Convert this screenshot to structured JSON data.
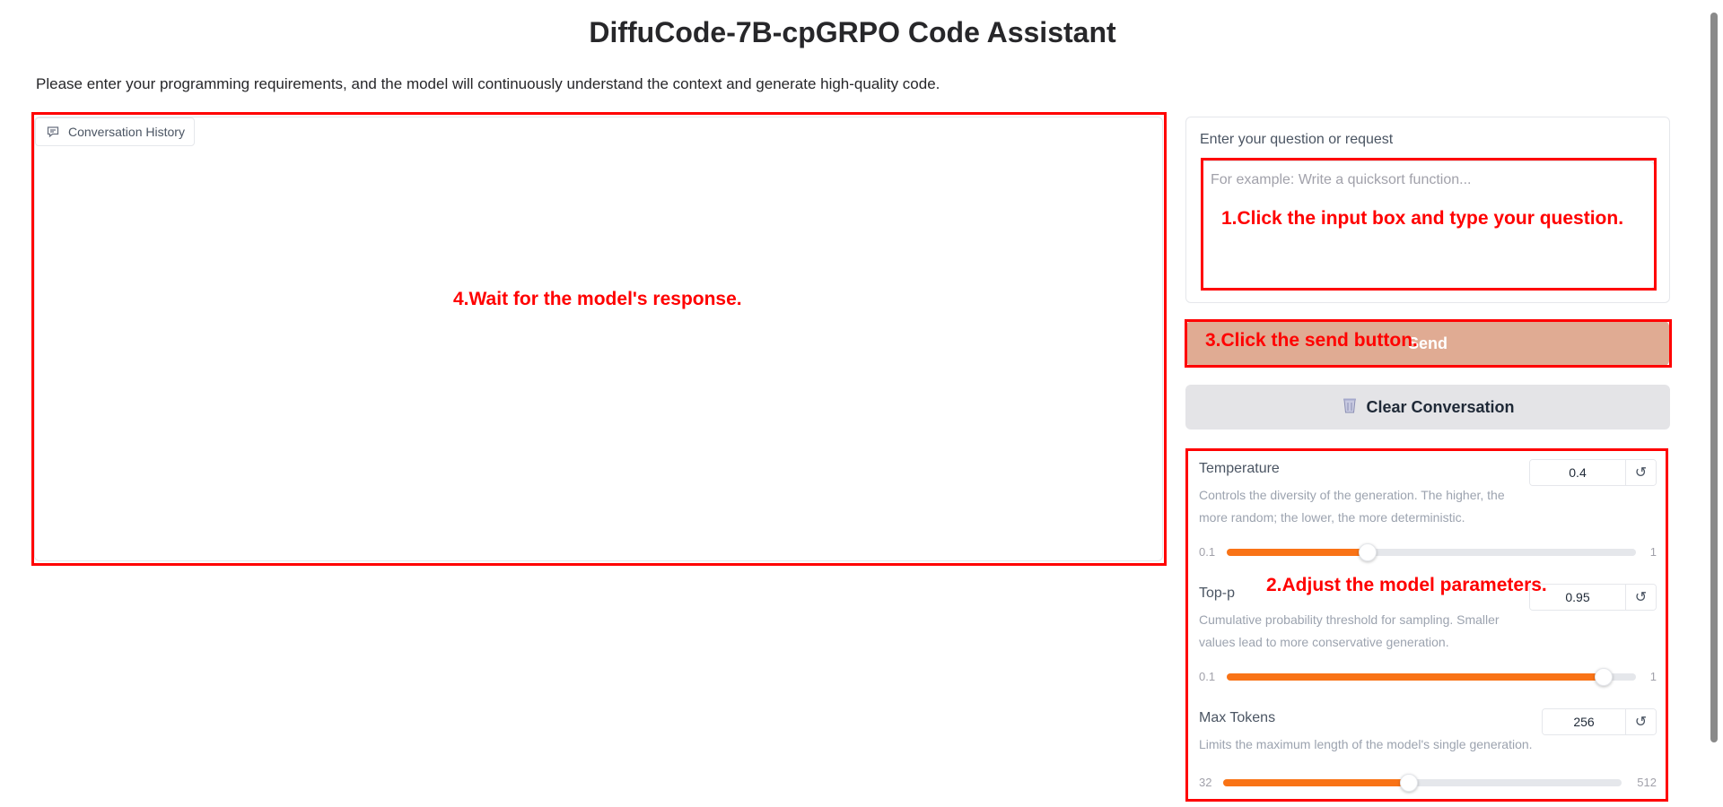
{
  "page": {
    "title": "DiffuCode-7B-cpGRPO Code Assistant",
    "description": "Please enter your programming requirements, and the model will continuously understand the context and generate high-quality code."
  },
  "chat": {
    "label": "Conversation History",
    "icon": "chat-bubble-icon"
  },
  "input": {
    "label": "Enter your question or request",
    "placeholder": "For example: Write a quicksort function...",
    "value": ""
  },
  "buttons": {
    "send": "Send",
    "clear": "Clear Conversation",
    "clear_icon": "trash-icon",
    "reset_icon": "reset-icon"
  },
  "params": {
    "temperature": {
      "name": "Temperature",
      "info": "Controls the diversity of the generation. The higher, the more random; the lower, the more deterministic.",
      "value": "0.4",
      "min": "0.1",
      "max": "1"
    },
    "top_p": {
      "name": "Top-p",
      "info": "Cumulative probability threshold for sampling. Smaller values lead to more conservative generation.",
      "value": "0.95",
      "min": "0.1",
      "max": "1"
    },
    "max_tokens": {
      "name": "Max Tokens",
      "info": "Limits the maximum length of the model's single generation.",
      "value": "256",
      "min": "32",
      "max": "512"
    }
  },
  "annotations": {
    "step1": "1.Click the input box and type your question.",
    "step2": "2.Adjust the model parameters.",
    "step3": "3.Click the send button.",
    "step4": "4.Wait for the model's response.",
    "color": "#ff0000"
  },
  "colors": {
    "accent": "#f97316",
    "send_button": "#e0ab93",
    "clear_button": "#e4e4e7"
  }
}
